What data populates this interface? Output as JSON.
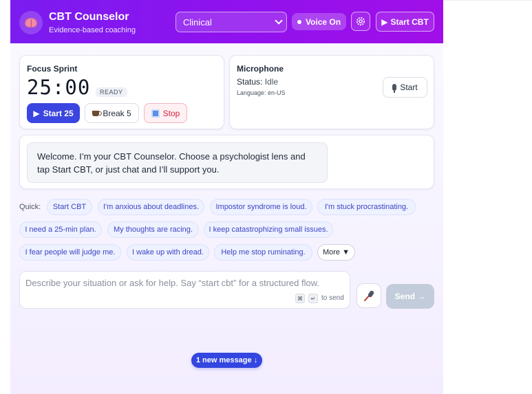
{
  "header": {
    "title": "CBT Counselor",
    "subtitle": "Evidence-based coaching",
    "lens_select": "Clinical",
    "voice_label": "Voice On",
    "start_cbt_label": "Start CBT"
  },
  "focus": {
    "title": "Focus Sprint",
    "timer": "25:00",
    "status": "READY",
    "start_label": "Start 25",
    "break_label": "Break 5",
    "stop_label": "Stop"
  },
  "mic": {
    "title": "Microphone",
    "status_label": "Status:",
    "status_value": "Idle",
    "language": "Language: en-US",
    "start_label": "Start"
  },
  "chat": {
    "welcome": "Welcome. I’m your CBT Counselor. Choose a psychologist lens and tap Start CBT, or just chat and I’ll support you."
  },
  "quick": {
    "label": "Quick:",
    "chips": [
      "Start CBT",
      "I'm anxious about deadlines.",
      "Impostor syndrome is loud.",
      "I'm stuck procrastinating.",
      "I need a 25-min plan.",
      "My thoughts are racing.",
      "I keep catastrophizing small issues.",
      "I fear people will judge me.",
      "I wake up with dread.",
      "Help me stop ruminating."
    ],
    "more_label": "More ▼"
  },
  "composer": {
    "placeholder": "Describe your situation or ask for help. Say “start cbt” for a structured flow.",
    "kbd_cmd": "⌘",
    "kbd_enter": "↵",
    "hint": "to send",
    "send_label": "Send →"
  },
  "new_message_label": "1 new message ↓",
  "icons": {
    "logo": "brain-icon",
    "settings": "gear-icon",
    "mic": "microphone-icon"
  },
  "colors": {
    "header_gradient_start": "#7a1cf0",
    "header_gradient_end": "#a10fe8",
    "primary_button": "#3b45e0",
    "stop_text": "#d4213d",
    "chip_text": "#3b45c4",
    "send_disabled": "#c3ccda"
  }
}
